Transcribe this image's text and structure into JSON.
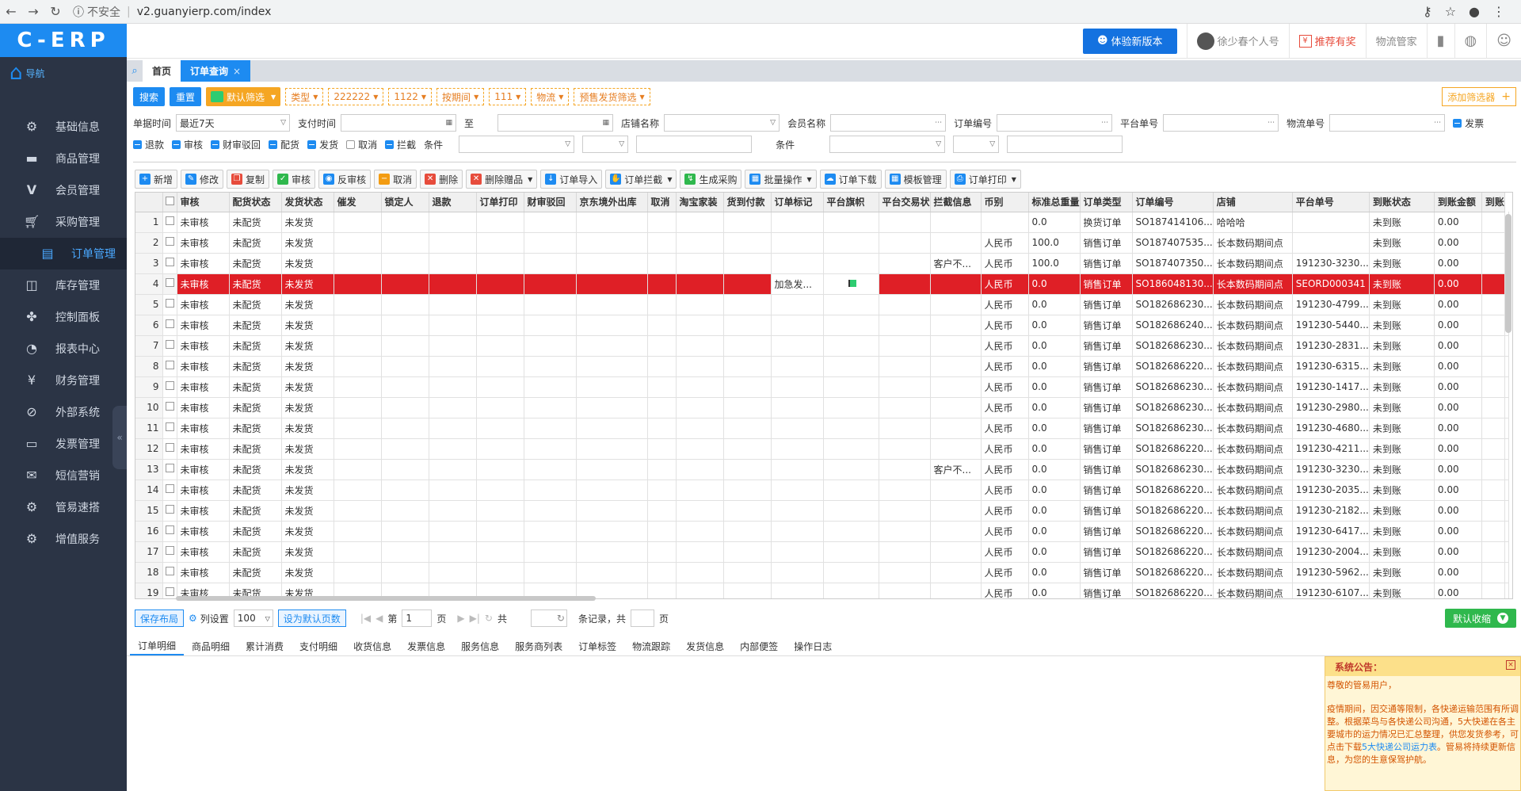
{
  "browser": {
    "security": "不安全",
    "url": "v2.guanyierp.com/index"
  },
  "sidebar": {
    "logo": "C-ERP",
    "nav_label": "导航",
    "items": [
      {
        "label": "基础信息",
        "icon": "gear-icon"
      },
      {
        "label": "商品管理",
        "icon": "store-icon"
      },
      {
        "label": "会员管理",
        "icon": "v-icon"
      },
      {
        "label": "采购管理",
        "icon": "cart-icon"
      },
      {
        "label": "订单管理",
        "icon": "clipboard-icon"
      },
      {
        "label": "库存管理",
        "icon": "box-icon"
      },
      {
        "label": "控制面板",
        "icon": "dashboard-icon"
      },
      {
        "label": "报表中心",
        "icon": "pie-icon"
      },
      {
        "label": "财务管理",
        "icon": "yen-icon"
      },
      {
        "label": "外部系统",
        "icon": "link-icon"
      },
      {
        "label": "发票管理",
        "icon": "invoice-icon"
      },
      {
        "label": "短信营销",
        "icon": "mail-icon"
      },
      {
        "label": "管易速搭",
        "icon": "gear-icon"
      },
      {
        "label": "增值服务",
        "icon": "gear-icon"
      }
    ]
  },
  "topbar": {
    "new_version": "体验新版本",
    "user": "徐少春个人号",
    "recommend": "推荐有奖",
    "logistics": "物流管家"
  },
  "tabs": [
    {
      "label": "首页"
    },
    {
      "label": "订单查询"
    }
  ],
  "filterbar": {
    "search": "搜索",
    "reset": "重置",
    "default_filter": "默认筛选",
    "chips": [
      "类型",
      "222222",
      "1122",
      "按期间",
      "111",
      "物流",
      "预售发货筛选"
    ],
    "add_filter": "添加筛选器"
  },
  "form": {
    "doc_time_label": "单据时间",
    "doc_time_value": "最近7天",
    "pay_time_label": "支付时间",
    "to_label": "至",
    "shop_label": "店铺名称",
    "member_label": "会员名称",
    "order_no_label": "订单编号",
    "platform_no_label": "平台单号",
    "logistics_no_label": "物流单号",
    "invoice_label": "发票",
    "checks": [
      {
        "label": "退款",
        "on": true
      },
      {
        "label": "审核",
        "on": true
      },
      {
        "label": "财审驳回",
        "on": true
      },
      {
        "label": "配货",
        "on": true
      },
      {
        "label": "发货",
        "on": true
      },
      {
        "label": "取消",
        "on": false
      },
      {
        "label": "拦截",
        "on": true
      }
    ],
    "cond_label": "条件",
    "cond_label2": "条件"
  },
  "toolbar": [
    {
      "label": "新增",
      "color": "#1d8bf1",
      "glyph": "+"
    },
    {
      "label": "修改",
      "color": "#1d8bf1",
      "glyph": "✎"
    },
    {
      "label": "复制",
      "color": "#e74c3c",
      "glyph": "❐"
    },
    {
      "label": "审核",
      "color": "#2fb84d",
      "glyph": "✓"
    },
    {
      "label": "反审核",
      "color": "#1d8bf1",
      "glyph": "◉"
    },
    {
      "label": "取消",
      "color": "#f39c12",
      "glyph": "−"
    },
    {
      "label": "删除",
      "color": "#e74c3c",
      "glyph": "✕"
    },
    {
      "label": "删除赠品",
      "color": "#e74c3c",
      "glyph": "✕",
      "dropdown": true
    },
    {
      "label": "订单导入",
      "color": "#1d8bf1",
      "glyph": "↓"
    },
    {
      "label": "订单拦截",
      "color": "#1d8bf1",
      "glyph": "✋",
      "dropdown": true
    },
    {
      "label": "生成采购",
      "color": "#2fb84d",
      "glyph": "↯"
    },
    {
      "label": "批量操作",
      "color": "#1d8bf1",
      "glyph": "▦",
      "dropdown": true
    },
    {
      "label": "订单下载",
      "color": "#1d8bf1",
      "glyph": "☁"
    },
    {
      "label": "模板管理",
      "color": "#1d8bf1",
      "glyph": "▦"
    },
    {
      "label": "订单打印",
      "color": "#1d8bf1",
      "glyph": "⎙",
      "dropdown": true
    }
  ],
  "table": {
    "columns": [
      "审核",
      "配货状态",
      "发货状态",
      "催发",
      "锁定人",
      "退款",
      "订单打印",
      "财审驳回",
      "京东境外出库",
      "取消",
      "淘宝家装",
      "货到付款",
      "订单标记",
      "平台旗帜",
      "平台交易状",
      "拦截信息",
      "币别",
      "标准总重量",
      "订单类型",
      "订单编号",
      "店铺",
      "平台单号",
      "到账状态",
      "到账金额",
      "到账"
    ],
    "rows": [
      {
        "n": "1",
        "c": [
          "未审核",
          "未配货",
          "未发货",
          "",
          "",
          "",
          "",
          "",
          "",
          "",
          "",
          "",
          "",
          "",
          "",
          "",
          "",
          "0.0",
          "换货订单",
          "SO187414106...",
          "哈哈哈",
          "",
          "未到账",
          "0.00",
          ""
        ]
      },
      {
        "n": "2",
        "c": [
          "未审核",
          "未配货",
          "未发货",
          "",
          "",
          "",
          "",
          "",
          "",
          "",
          "",
          "",
          "",
          "",
          "",
          "",
          "人民币",
          "100.0",
          "销售订单",
          "SO187407535...",
          "长本数码期间点",
          "",
          "未到账",
          "0.00",
          ""
        ]
      },
      {
        "n": "3",
        "c": [
          "未审核",
          "未配货",
          "未发货",
          "",
          "",
          "",
          "",
          "",
          "",
          "",
          "",
          "",
          "",
          "",
          "",
          "客户不...",
          "人民币",
          "100.0",
          "销售订单",
          "SO187407350...",
          "长本数码期间点",
          "191230-3230...",
          "未到账",
          "0.00",
          ""
        ]
      },
      {
        "n": "4",
        "hl": true,
        "c": [
          "未审核",
          "未配货",
          "未发货",
          "",
          "",
          "",
          "",
          "",
          "",
          "",
          "",
          "",
          "加急发...",
          "FLAG",
          "",
          "",
          "人民币",
          "0.0",
          "销售订单",
          "SO186048130...",
          "长本数码期间点",
          "SEORD000341",
          "未到账",
          "0.00",
          ""
        ]
      },
      {
        "n": "5",
        "c": [
          "未审核",
          "未配货",
          "未发货",
          "",
          "",
          "",
          "",
          "",
          "",
          "",
          "",
          "",
          "",
          "",
          "",
          "",
          "人民币",
          "0.0",
          "销售订单",
          "SO182686230...",
          "长本数码期间点",
          "191230-4799...",
          "未到账",
          "0.00",
          ""
        ]
      },
      {
        "n": "6",
        "c": [
          "未审核",
          "未配货",
          "未发货",
          "",
          "",
          "",
          "",
          "",
          "",
          "",
          "",
          "",
          "",
          "",
          "",
          "",
          "人民币",
          "0.0",
          "销售订单",
          "SO182686240...",
          "长本数码期间点",
          "191230-5440...",
          "未到账",
          "0.00",
          ""
        ]
      },
      {
        "n": "7",
        "c": [
          "未审核",
          "未配货",
          "未发货",
          "",
          "",
          "",
          "",
          "",
          "",
          "",
          "",
          "",
          "",
          "",
          "",
          "",
          "人民币",
          "0.0",
          "销售订单",
          "SO182686230...",
          "长本数码期间点",
          "191230-2831...",
          "未到账",
          "0.00",
          ""
        ]
      },
      {
        "n": "8",
        "c": [
          "未审核",
          "未配货",
          "未发货",
          "",
          "",
          "",
          "",
          "",
          "",
          "",
          "",
          "",
          "",
          "",
          "",
          "",
          "人民币",
          "0.0",
          "销售订单",
          "SO182686220...",
          "长本数码期间点",
          "191230-6315...",
          "未到账",
          "0.00",
          ""
        ]
      },
      {
        "n": "9",
        "c": [
          "未审核",
          "未配货",
          "未发货",
          "",
          "",
          "",
          "",
          "",
          "",
          "",
          "",
          "",
          "",
          "",
          "",
          "",
          "人民币",
          "0.0",
          "销售订单",
          "SO182686230...",
          "长本数码期间点",
          "191230-1417...",
          "未到账",
          "0.00",
          ""
        ]
      },
      {
        "n": "10",
        "c": [
          "未审核",
          "未配货",
          "未发货",
          "",
          "",
          "",
          "",
          "",
          "",
          "",
          "",
          "",
          "",
          "",
          "",
          "",
          "人民币",
          "0.0",
          "销售订单",
          "SO182686230...",
          "长本数码期间点",
          "191230-2980...",
          "未到账",
          "0.00",
          ""
        ]
      },
      {
        "n": "11",
        "c": [
          "未审核",
          "未配货",
          "未发货",
          "",
          "",
          "",
          "",
          "",
          "",
          "",
          "",
          "",
          "",
          "",
          "",
          "",
          "人民币",
          "0.0",
          "销售订单",
          "SO182686230...",
          "长本数码期间点",
          "191230-4680...",
          "未到账",
          "0.00",
          ""
        ]
      },
      {
        "n": "12",
        "c": [
          "未审核",
          "未配货",
          "未发货",
          "",
          "",
          "",
          "",
          "",
          "",
          "",
          "",
          "",
          "",
          "",
          "",
          "",
          "人民币",
          "0.0",
          "销售订单",
          "SO182686220...",
          "长本数码期间点",
          "191230-4211...",
          "未到账",
          "0.00",
          ""
        ]
      },
      {
        "n": "13",
        "c": [
          "未审核",
          "未配货",
          "未发货",
          "",
          "",
          "",
          "",
          "",
          "",
          "",
          "",
          "",
          "",
          "",
          "",
          "客户不...",
          "人民币",
          "0.0",
          "销售订单",
          "SO182686230...",
          "长本数码期间点",
          "191230-3230...",
          "未到账",
          "0.00",
          ""
        ]
      },
      {
        "n": "14",
        "c": [
          "未审核",
          "未配货",
          "未发货",
          "",
          "",
          "",
          "",
          "",
          "",
          "",
          "",
          "",
          "",
          "",
          "",
          "",
          "人民币",
          "0.0",
          "销售订单",
          "SO182686220...",
          "长本数码期间点",
          "191230-2035...",
          "未到账",
          "0.00",
          ""
        ]
      },
      {
        "n": "15",
        "c": [
          "未审核",
          "未配货",
          "未发货",
          "",
          "",
          "",
          "",
          "",
          "",
          "",
          "",
          "",
          "",
          "",
          "",
          "",
          "人民币",
          "0.0",
          "销售订单",
          "SO182686220...",
          "长本数码期间点",
          "191230-2182...",
          "未到账",
          "0.00",
          ""
        ]
      },
      {
        "n": "16",
        "c": [
          "未审核",
          "未配货",
          "未发货",
          "",
          "",
          "",
          "",
          "",
          "",
          "",
          "",
          "",
          "",
          "",
          "",
          "",
          "人民币",
          "0.0",
          "销售订单",
          "SO182686220...",
          "长本数码期间点",
          "191230-6417...",
          "未到账",
          "0.00",
          ""
        ]
      },
      {
        "n": "17",
        "c": [
          "未审核",
          "未配货",
          "未发货",
          "",
          "",
          "",
          "",
          "",
          "",
          "",
          "",
          "",
          "",
          "",
          "",
          "",
          "人民币",
          "0.0",
          "销售订单",
          "SO182686220...",
          "长本数码期间点",
          "191230-2004...",
          "未到账",
          "0.00",
          ""
        ]
      },
      {
        "n": "18",
        "c": [
          "未审核",
          "未配货",
          "未发货",
          "",
          "",
          "",
          "",
          "",
          "",
          "",
          "",
          "",
          "",
          "",
          "",
          "",
          "人民币",
          "0.0",
          "销售订单",
          "SO182686220...",
          "长本数码期间点",
          "191230-5962...",
          "未到账",
          "0.00",
          ""
        ]
      },
      {
        "n": "19",
        "c": [
          "未审核",
          "未配货",
          "未发货",
          "",
          "",
          "",
          "",
          "",
          "",
          "",
          "",
          "",
          "",
          "",
          "",
          "",
          "人民币",
          "0.0",
          "销售订单",
          "SO182686220...",
          "长本数码期间点",
          "191230-6107...",
          "未到账",
          "0.00",
          ""
        ]
      }
    ]
  },
  "pager": {
    "save_layout": "保存布局",
    "col_settings": "列设置",
    "page_size": "100",
    "set_default": "设为默认页数",
    "page_prefix": "第",
    "page_value": "1",
    "page_suffix": "页",
    "total_prefix": "共",
    "records_label": "条记录，共",
    "pages_suffix": "页",
    "default_collect": "默认收缩"
  },
  "detail_tabs": [
    "订单明细",
    "商品明细",
    "累计消费",
    "支付明细",
    "收货信息",
    "发票信息",
    "服务信息",
    "服务商列表",
    "订单标签",
    "物流跟踪",
    "发货信息",
    "内部便签",
    "操作日志"
  ],
  "notice": {
    "title": "系统公告：",
    "greeting": "尊敬的管易用户，",
    "body": "疫情期间，因交通等限制，各快递运输范围有所调整。根据菜鸟与各快递公司沟通，5大快递在各主要城市的运力情况已汇总整理，供您发货参考，可点击下载",
    "link": "5大快递公司运力表",
    "tail": "。管易将持续更新信息，为您的生意保驾护航。"
  }
}
